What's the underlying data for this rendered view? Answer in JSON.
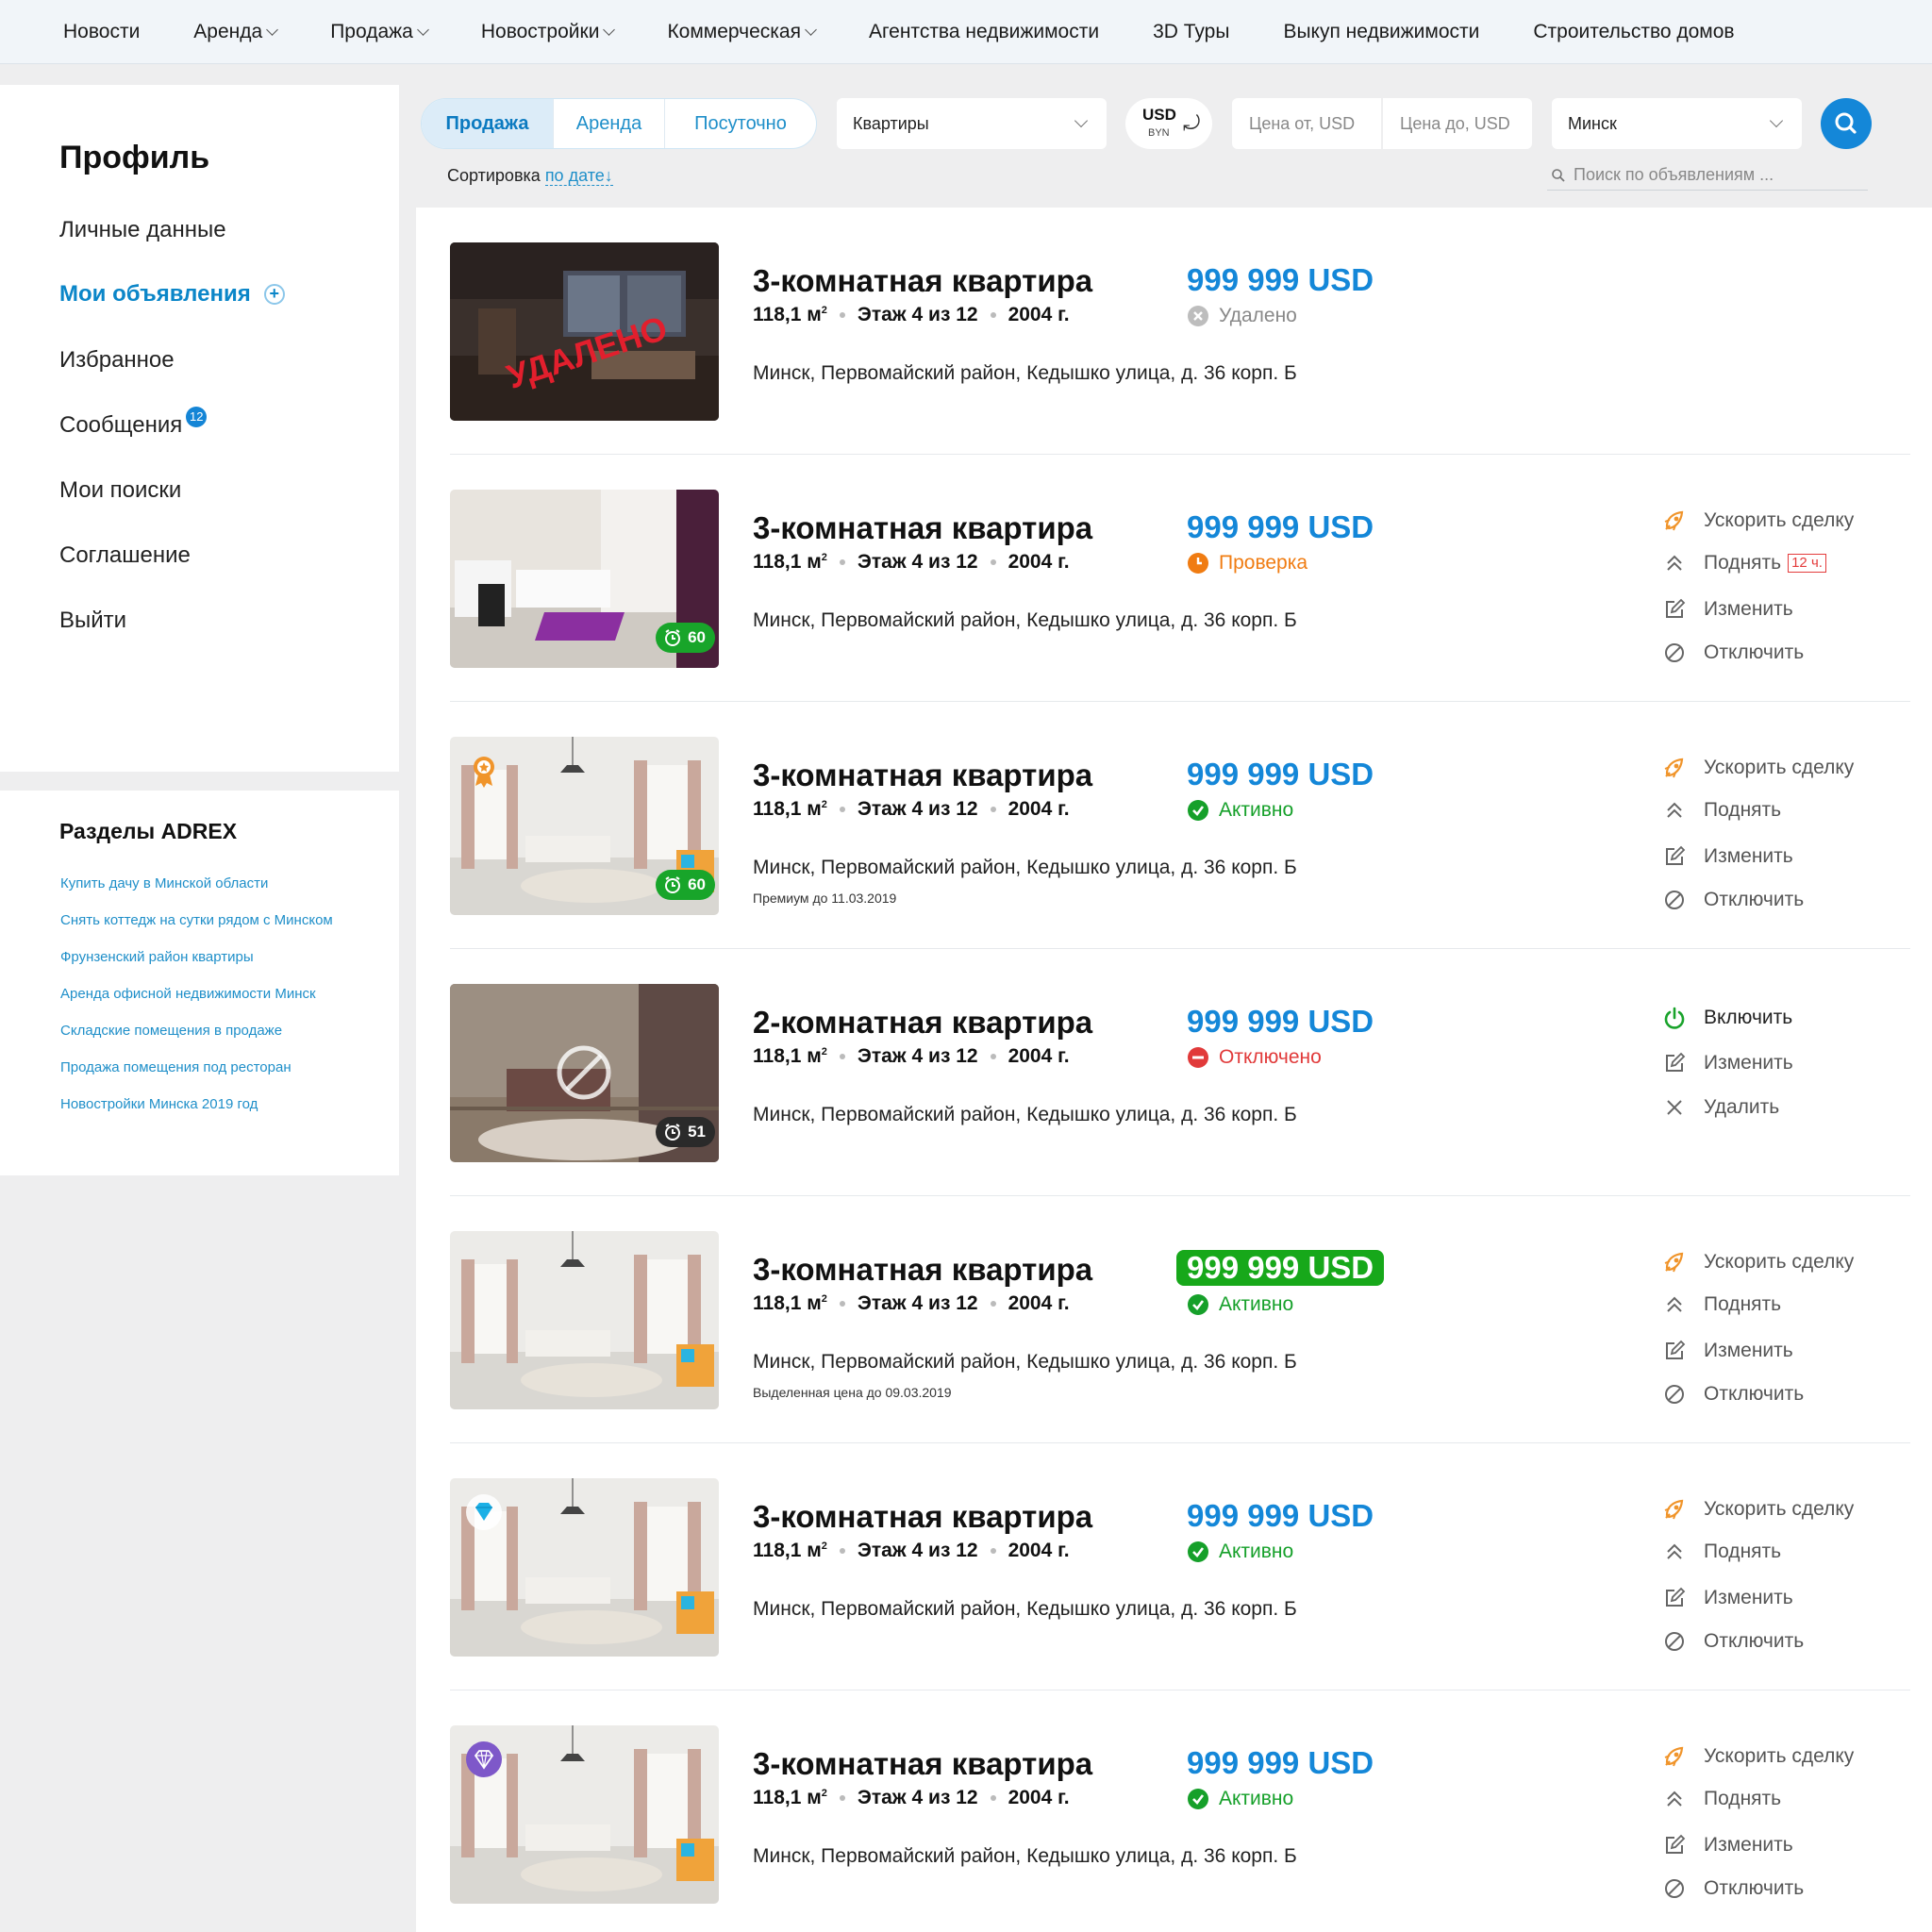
{
  "topnav": [
    {
      "label": "Новости",
      "dropdown": false
    },
    {
      "label": "Аренда",
      "dropdown": true
    },
    {
      "label": "Продажа",
      "dropdown": true
    },
    {
      "label": "Новостройки",
      "dropdown": true
    },
    {
      "label": "Коммерческая",
      "dropdown": true
    },
    {
      "label": "Агентства недвижимости",
      "dropdown": false
    },
    {
      "label": "3D Туры",
      "dropdown": false
    },
    {
      "label": "Выкуп недвижимости",
      "dropdown": false
    },
    {
      "label": "Строительство домов",
      "dropdown": false
    }
  ],
  "profile": {
    "title": "Профиль",
    "menu": [
      {
        "label": "Личные данные"
      },
      {
        "label": "Мои объявления",
        "active": true,
        "plus": "+"
      },
      {
        "label": "Избранное"
      },
      {
        "label": "Сообщения",
        "badge": "12"
      },
      {
        "label": "Мои поиски"
      },
      {
        "label": "Соглашение"
      },
      {
        "label": "Выйти"
      }
    ]
  },
  "sections": {
    "title": "Разделы ADREX",
    "links": [
      "Купить дачу в Минской области",
      "Снять коттедж на сутки рядом с Минском",
      "Фрунзенский район квартиры",
      "Аренда офисной недвижимости Минск",
      "Складские помещения в продаже",
      "Продажа помещения под ресторан",
      "Новостройки Минска 2019 год"
    ]
  },
  "filters": {
    "deal_tabs": [
      {
        "label": "Продажа",
        "active": true
      },
      {
        "label": "Аренда"
      },
      {
        "label": "Посуточно"
      }
    ],
    "property_type": "Квартиры",
    "currency_main": "USD",
    "currency_alt": "BYN",
    "price_from_placeholder": "Цена от, USD",
    "price_to_placeholder": "Цена до, USD",
    "city": "Минск",
    "sort_label": "Сортировка",
    "sort_value": "по дате",
    "search_placeholder": "Поиск по объявлениям ..."
  },
  "listings": [
    {
      "title": "3-комнатная квартира",
      "area": "118,1 м",
      "area_sup": "2",
      "floor": "Этаж 4 из 12",
      "year": "2004 г.",
      "price": "999 999 USD",
      "price_highlight": false,
      "status": "Удалено",
      "status_type": "deleted",
      "address": "Минск, Первомайский район, Кедышко улица, д. 36 корп. Б",
      "note": "",
      "photo": "dark",
      "overlay_text": "УДАЛЕНО",
      "timer": "",
      "promo": "",
      "actions": []
    },
    {
      "title": "3-комнатная квартира",
      "area": "118,1 м",
      "area_sup": "2",
      "floor": "Этаж 4 из 12",
      "year": "2004 г.",
      "price": "999 999 USD",
      "price_highlight": false,
      "status": "Проверка",
      "status_type": "review",
      "address": "Минск, Первомайский район, Кедышко улица, д. 36 корп. Б",
      "note": "",
      "photo": "bedroom",
      "overlay_text": "",
      "timer": "60",
      "timer_style": "green",
      "promo": "",
      "actions": [
        {
          "label": "Ускорить сделку",
          "icon": "rocket-icon"
        },
        {
          "label": "Поднять",
          "icon": "raise-icon",
          "badge": "12 ч."
        },
        {
          "label": "Изменить",
          "icon": "edit-icon"
        },
        {
          "label": "Отключить",
          "icon": "disable-icon"
        }
      ]
    },
    {
      "title": "3-комнатная квартира",
      "area": "118,1 м",
      "area_sup": "2",
      "floor": "Этаж 4 из 12",
      "year": "2004 г.",
      "price": "999 999 USD",
      "price_highlight": false,
      "status": "Активно",
      "status_type": "active",
      "address": "Минск, Первомайский район, Кедышко улица, д. 36 корп. Б",
      "note": "Премиум до 11.03.2019",
      "photo": "living",
      "overlay_text": "",
      "timer": "60",
      "timer_style": "green",
      "promo": "premium-medal-icon",
      "actions": [
        {
          "label": "Ускорить сделку",
          "icon": "rocket-icon"
        },
        {
          "label": "Поднять",
          "icon": "raise-icon"
        },
        {
          "label": "Изменить",
          "icon": "edit-icon"
        },
        {
          "label": "Отключить",
          "icon": "disable-icon"
        }
      ]
    },
    {
      "title": "2-комнатная квартира",
      "area": "118,1 м",
      "area_sup": "2",
      "floor": "Этаж 4 из 12",
      "year": "2004 г.",
      "price": "999 999 USD",
      "price_highlight": false,
      "status": "Отключено",
      "status_type": "off",
      "address": "Минск, Первомайский район, Кедышко улица, д. 36 корп. Б",
      "note": "",
      "photo": "lounge",
      "overlay_text": "",
      "timer": "51",
      "timer_style": "dark",
      "promo": "",
      "disabled_overlay": true,
      "actions": [
        {
          "label": "Включить",
          "icon": "power-icon"
        },
        {
          "label": "Изменить",
          "icon": "edit-icon"
        },
        {
          "label": "Удалить",
          "icon": "close-icon"
        }
      ]
    },
    {
      "title": "3-комнатная квартира",
      "area": "118,1 м",
      "area_sup": "2",
      "floor": "Этаж 4 из 12",
      "year": "2004 г.",
      "price": "999 999 USD",
      "price_highlight": true,
      "status": "Активно",
      "status_type": "active",
      "address": "Минск, Первомайский район, Кедышко улица, д. 36 корп. Б",
      "note": "Выделенная цена до 09.03.2019",
      "photo": "living",
      "overlay_text": "",
      "timer": "",
      "promo": "",
      "actions": [
        {
          "label": "Ускорить сделку",
          "icon": "rocket-icon"
        },
        {
          "label": "Поднять",
          "icon": "raise-icon"
        },
        {
          "label": "Изменить",
          "icon": "edit-icon"
        },
        {
          "label": "Отключить",
          "icon": "disable-icon"
        }
      ]
    },
    {
      "title": "3-комнатная квартира",
      "area": "118,1 м",
      "area_sup": "2",
      "floor": "Этаж 4 из 12",
      "year": "2004 г.",
      "price": "999 999 USD",
      "price_highlight": false,
      "status": "Активно",
      "status_type": "active",
      "address": "Минск, Первомайский район, Кедышко улица, д. 36 корп. Б",
      "note": "",
      "photo": "living",
      "overlay_text": "",
      "timer": "",
      "promo": "blue-diamond-icon",
      "actions": [
        {
          "label": "Ускорить сделку",
          "icon": "rocket-icon"
        },
        {
          "label": "Поднять",
          "icon": "raise-icon"
        },
        {
          "label": "Изменить",
          "icon": "edit-icon"
        },
        {
          "label": "Отключить",
          "icon": "disable-icon"
        }
      ]
    },
    {
      "title": "3-комнатная квартира",
      "area": "118,1 м",
      "area_sup": "2",
      "floor": "Этаж 4 из 12",
      "year": "2004 г.",
      "price": "999 999 USD",
      "price_highlight": false,
      "status": "Активно",
      "status_type": "active",
      "address": "Минск, Первомайский район, Кедышко улица, д. 36 корп. Б",
      "note": "",
      "photo": "living",
      "overlay_text": "",
      "timer": "",
      "promo": "purple-diamond-icon",
      "actions": [
        {
          "label": "Ускорить сделку",
          "icon": "rocket-icon"
        },
        {
          "label": "Поднять",
          "icon": "raise-icon"
        },
        {
          "label": "Изменить",
          "icon": "edit-icon"
        },
        {
          "label": "Отключить",
          "icon": "disable-icon"
        }
      ]
    }
  ],
  "colors": {
    "accent": "#1487d8",
    "active": "#16a02a",
    "review": "#f07c12",
    "off": "#e13a3a",
    "boost": "#f0942a"
  }
}
